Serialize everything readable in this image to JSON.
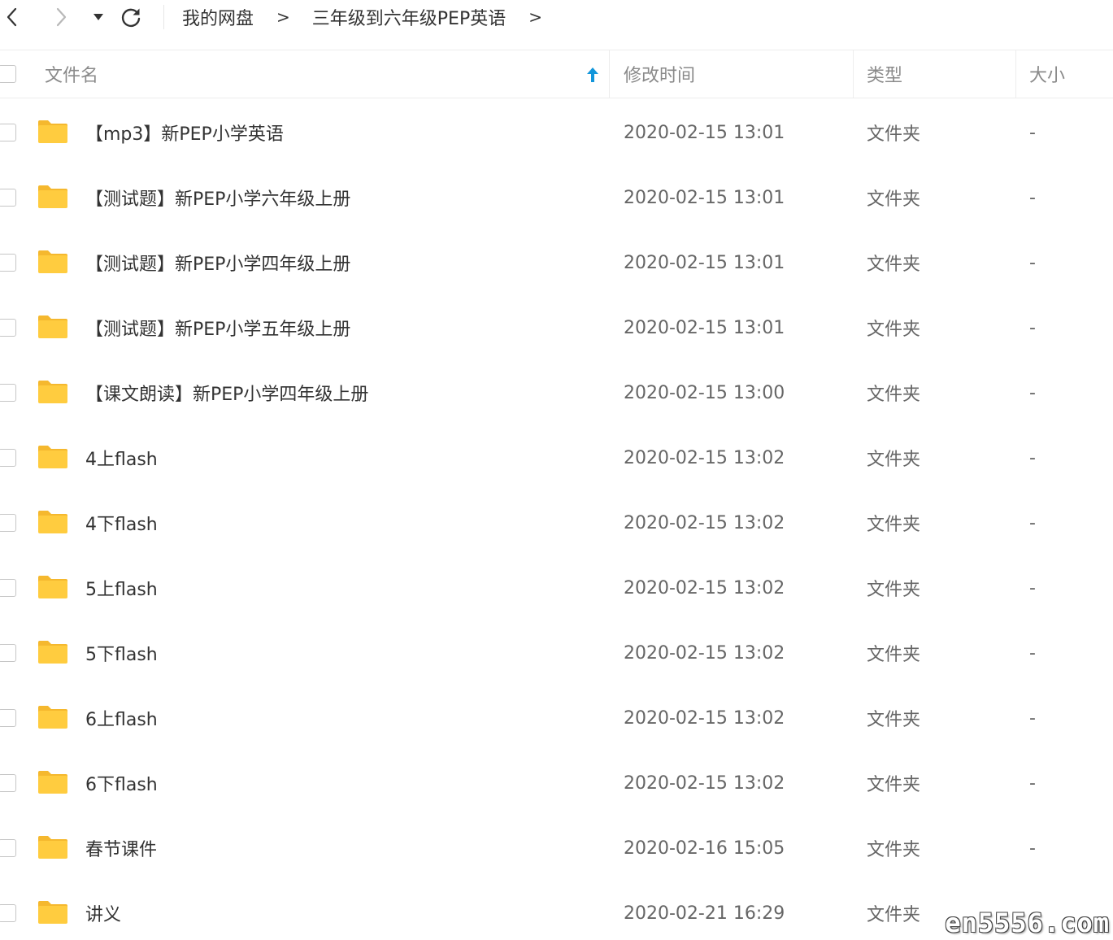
{
  "nav": {
    "back_icon": "chevron-left-icon",
    "forward_icon": "chevron-right-icon",
    "dropdown_icon": "caret-down-icon",
    "refresh_icon": "refresh-icon"
  },
  "breadcrumb": {
    "items": [
      "我的网盘",
      "三年级到六年级PEP英语"
    ],
    "separator": ">"
  },
  "table": {
    "headers": {
      "name": "文件名",
      "mtime": "修改时间",
      "type": "类型",
      "size": "大小"
    },
    "sort": {
      "column": "name",
      "direction": "ascending",
      "icon": "arrow-up-icon",
      "color": "#1296db"
    },
    "rows": [
      {
        "name": "【mp3】新PEP小学英语",
        "mtime": "2020-02-15 13:01",
        "type": "文件夹",
        "size": "-"
      },
      {
        "name": "【测试题】新PEP小学六年级上册",
        "mtime": "2020-02-15 13:01",
        "type": "文件夹",
        "size": "-"
      },
      {
        "name": "【测试题】新PEP小学四年级上册",
        "mtime": "2020-02-15 13:01",
        "type": "文件夹",
        "size": "-"
      },
      {
        "name": "【测试题】新PEP小学五年级上册",
        "mtime": "2020-02-15 13:01",
        "type": "文件夹",
        "size": "-"
      },
      {
        "name": "【课文朗读】新PEP小学四年级上册",
        "mtime": "2020-02-15 13:00",
        "type": "文件夹",
        "size": "-"
      },
      {
        "name": "4上flash",
        "mtime": "2020-02-15 13:02",
        "type": "文件夹",
        "size": "-"
      },
      {
        "name": "4下flash",
        "mtime": "2020-02-15 13:02",
        "type": "文件夹",
        "size": "-"
      },
      {
        "name": "5上flash",
        "mtime": "2020-02-15 13:02",
        "type": "文件夹",
        "size": "-"
      },
      {
        "name": "5下flash",
        "mtime": "2020-02-15 13:02",
        "type": "文件夹",
        "size": "-"
      },
      {
        "name": "6上flash",
        "mtime": "2020-02-15 13:02",
        "type": "文件夹",
        "size": "-"
      },
      {
        "name": "6下flash",
        "mtime": "2020-02-15 13:02",
        "type": "文件夹",
        "size": "-"
      },
      {
        "name": "春节课件",
        "mtime": "2020-02-16 15:05",
        "type": "文件夹",
        "size": "-"
      },
      {
        "name": "讲义",
        "mtime": "2020-02-21 16:29",
        "type": "文件夹",
        "size": ""
      }
    ]
  },
  "colors": {
    "folder": "#ffcc3f",
    "folder_tab": "#f5b82e",
    "sort_arrow": "#1296db",
    "divider": "#ededed",
    "header_text": "#8a8a8a"
  },
  "watermark": {
    "text": "en5556.com"
  }
}
